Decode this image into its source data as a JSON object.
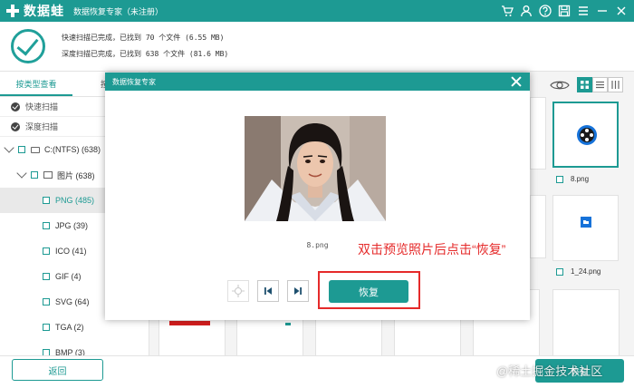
{
  "app": {
    "name": "数据蛙",
    "subtitle": "数据恢复专家（未注册）"
  },
  "titlebar_icons": [
    "cart-icon",
    "user-icon",
    "help-icon",
    "save-icon",
    "menu-icon",
    "minimize-icon",
    "close-icon"
  ],
  "status": {
    "quick_scan": "快速扫描已完成，已找到 70 个文件 (6.55 MB)",
    "deep_scan": "深度扫描已完成，已找到 638 个文件 (81.6 MB)"
  },
  "left": {
    "tabs": [
      "按类型查看",
      "按路"
    ],
    "scan_items": [
      "快速扫描",
      "深度扫描"
    ],
    "drive": "C:(NTFS) (638)",
    "folder": "图片 (638)",
    "file_types": [
      {
        "label": "PNG (485)",
        "selected": true
      },
      {
        "label": "JPG (39)",
        "selected": false
      },
      {
        "label": "ICO (41)",
        "selected": false
      },
      {
        "label": "GIF (4)",
        "selected": false
      },
      {
        "label": "SVG (64)",
        "selected": false
      },
      {
        "label": "TGA (2)",
        "selected": false
      },
      {
        "label": "BMP (3)",
        "selected": false
      }
    ]
  },
  "grid": {
    "files": [
      "8.png",
      "1_24.png"
    ],
    "partial_label": "ng"
  },
  "dialog": {
    "title": "数据恢复专家",
    "filename": "8.png",
    "annotation": "双击预览照片后点击“恢复”",
    "recover_label": "恢复"
  },
  "bottom": {
    "back_label": "返回",
    "recover_label": "恢复",
    "watermark": "@稀土掘金技术社区"
  },
  "colors": {
    "accent": "#1d9a93",
    "annotation": "#e52a2a"
  }
}
